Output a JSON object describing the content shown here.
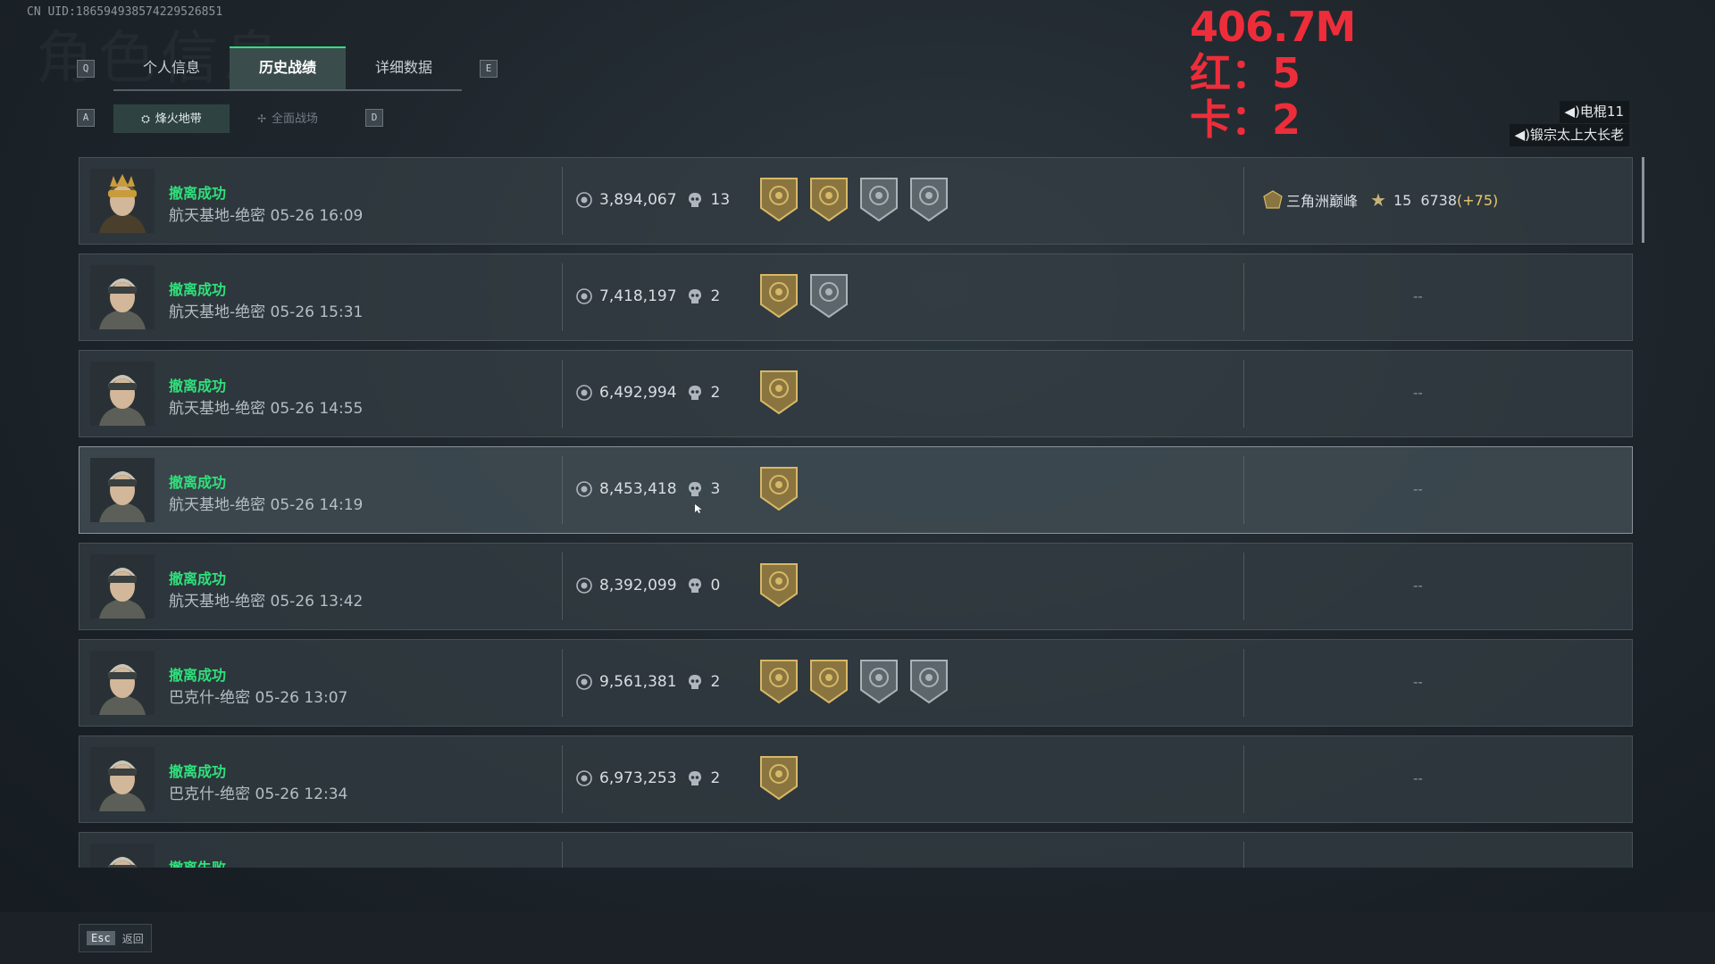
{
  "header": {
    "uid": "CN UID:18659493857422952685​1",
    "bg_watermark": "角色信息"
  },
  "overlay": {
    "value": "406.7M",
    "red": "红：5",
    "card": "卡：2"
  },
  "keys": {
    "q": "Q",
    "e": "E",
    "a": "A",
    "d": "D"
  },
  "tabs": [
    {
      "label": "个人信息"
    },
    {
      "label": "历史战绩",
      "active": true
    },
    {
      "label": "详细数据"
    }
  ],
  "subtabs": [
    {
      "label": "烽火地带",
      "active": true
    },
    {
      "label": "全面战场"
    }
  ],
  "speakers": [
    "◀)电棍11",
    "◀)锻宗太上大长老"
  ],
  "rows": [
    {
      "status": "撤离成功",
      "map": "航天基地-绝密",
      "time": "05-26 16:09",
      "value": "3,894,067",
      "kills": "13",
      "medals": [
        "gold",
        "gold",
        "silver",
        "silver"
      ],
      "rank": {
        "name": "三角洲巅峰",
        "stars": "15",
        "score": "6738",
        "delta": "(+75)"
      }
    },
    {
      "status": "撤离成功",
      "map": "航天基地-绝密",
      "time": "05-26 15:31",
      "value": "7,418,197",
      "kills": "2",
      "medals": [
        "gold",
        "silver"
      ],
      "rank_empty": "--"
    },
    {
      "status": "撤离成功",
      "map": "航天基地-绝密",
      "time": "05-26 14:55",
      "value": "6,492,994",
      "kills": "2",
      "medals": [
        "gold"
      ],
      "rank_empty": "--"
    },
    {
      "status": "撤离成功",
      "map": "航天基地-绝密",
      "time": "05-26 14:19",
      "value": "8,453,418",
      "kills": "3",
      "medals": [
        "gold"
      ],
      "rank_empty": "--"
    },
    {
      "status": "撤离成功",
      "map": "航天基地-绝密",
      "time": "05-26 13:42",
      "value": "8,392,099",
      "kills": "0",
      "medals": [
        "gold"
      ],
      "rank_empty": "--"
    },
    {
      "status": "撤离成功",
      "map": "巴克什-绝密",
      "time": "05-26 13:07",
      "value": "9,561,381",
      "kills": "2",
      "medals": [
        "gold",
        "gold",
        "silver",
        "silver"
      ],
      "rank_empty": "--"
    },
    {
      "status": "撤离成功",
      "map": "巴克什-绝密",
      "time": "05-26 12:34",
      "value": "6,973,253",
      "kills": "2",
      "medals": [
        "gold"
      ],
      "rank_empty": "--"
    },
    {
      "status": "撤离失败",
      "map": "",
      "time": "",
      "value": "",
      "kills": "",
      "medals": [],
      "rank_empty": ""
    }
  ],
  "footer": {
    "key": "Esc",
    "label": "返回"
  },
  "colors": {
    "success": "#2fe07b",
    "overlay": "#ee2d3a",
    "active_tab": "#3a4d4c"
  }
}
